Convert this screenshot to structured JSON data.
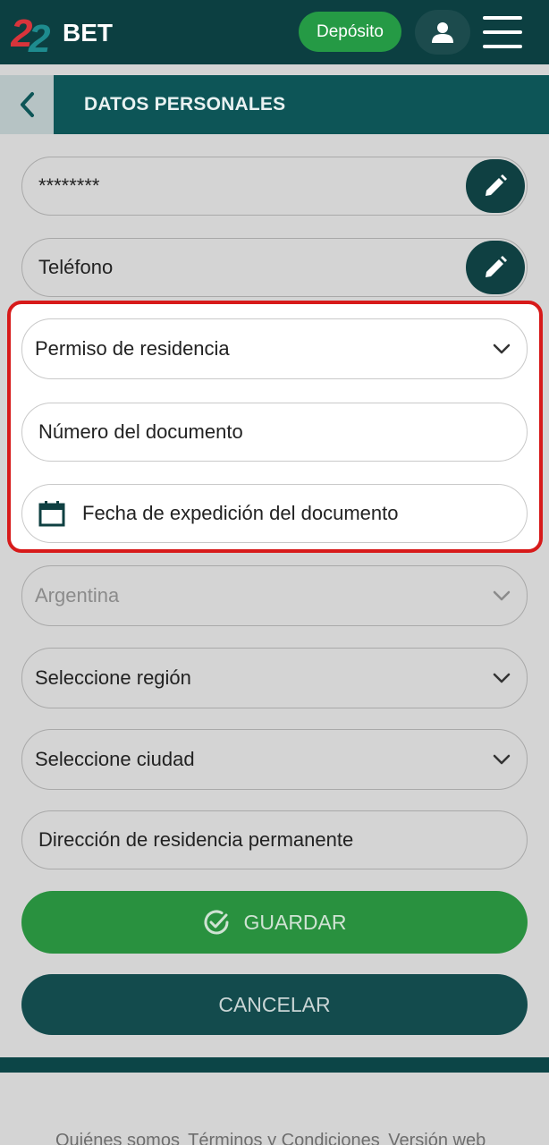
{
  "header": {
    "logo_text": "22BET",
    "deposit_label": "Depósito",
    "user_icon": "user-icon",
    "menu_icon": "hamburger-menu-icon"
  },
  "subheader": {
    "back_icon": "chevron-left-icon",
    "title": "DATOS PERSONALES"
  },
  "form": {
    "password_value": "********",
    "phone_placeholder": "Teléfono",
    "document_type": "Permiso de residencia",
    "document_number_placeholder": "Número del documento",
    "issue_date_placeholder": "Fecha de expedición del documento",
    "country": "Argentina",
    "region_placeholder": "Seleccione región",
    "city_placeholder": "Seleccione ciudad",
    "address_placeholder": "Dirección de residencia permanente"
  },
  "actions": {
    "save_label": "GUARDAR",
    "cancel_label": "CANCELAR"
  },
  "footer": {
    "links": [
      "Quiénes somos",
      "Términos y Condiciones",
      "Versión web"
    ]
  },
  "colors": {
    "header_bg": "#0c3f41",
    "subheader_bg": "#0d5557",
    "accent_green": "#259a45",
    "highlight_red": "#d71a1a",
    "cancel_bg": "#134b4d"
  }
}
